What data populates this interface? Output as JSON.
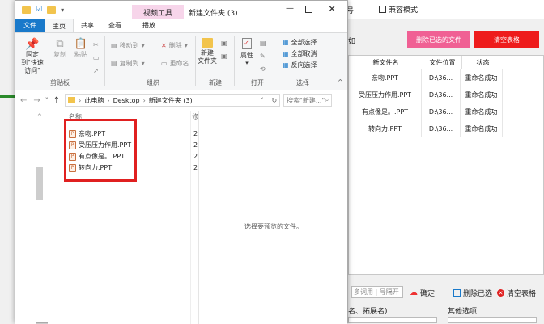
{
  "explorer": {
    "title": "新建文件夹 (3)",
    "context_tab": "视频工具",
    "tabs": [
      "文件",
      "主页",
      "共享",
      "查看",
      "播放"
    ],
    "clipboard": {
      "pin": "固定到\"快速访问\"",
      "copy": "复制",
      "paste": "粘贴",
      "group": "剪贴板"
    },
    "organize": {
      "move_to": "移动到",
      "copy_to": "复制到",
      "delete": "删除",
      "rename": "重命名",
      "group": "组织"
    },
    "new": {
      "new_folder": "新建\n文件夹",
      "group": "新建"
    },
    "open": {
      "properties": "属性",
      "group": "打开"
    },
    "select": {
      "select_all": "全部选择",
      "select_none": "全部取消",
      "invert": "反向选择",
      "group": "选择"
    },
    "address": {
      "crumbs": [
        "此电脑",
        "Desktop",
        "新建文件夹 (3)"
      ],
      "search_placeholder": "搜索\"新建...\""
    },
    "column_name": "名称",
    "column_short": "修",
    "files": [
      {
        "name": "亲吻.PPT",
        "date": "2"
      },
      {
        "name": "受压压力作用.PPT",
        "date": "2"
      },
      {
        "name": "有点像是。.PPT",
        "date": "2"
      },
      {
        "name": "转向力.PPT",
        "date": "2"
      }
    ],
    "preview_text": "选择要预览的文件。"
  },
  "bgapp": {
    "top_label": "号",
    "checkbox_label": "兼容模式",
    "side_label": "如",
    "delete_selected": "删除已选的文件",
    "clear_table": "清空表格",
    "columns": [
      "新文件名",
      "文件位置",
      "状态"
    ],
    "rows": [
      {
        "name": "亲吻.PPT",
        "loc": "D:\\36...",
        "status": "重命名成功"
      },
      {
        "name": "受压压力作用.PPT",
        "loc": "D:\\36...",
        "status": "重命名成功"
      },
      {
        "name": "有点像是。.PPT",
        "loc": "D:\\36...",
        "status": "重命名成功"
      },
      {
        "name": "转向力.PPT",
        "loc": "D:\\36...",
        "status": "重命名成功"
      }
    ],
    "input_placeholder": "多词用 | 号隔开",
    "confirm": "确定",
    "delete_selected2": "删除已选",
    "clear_table2": "清空表格",
    "section_left": "名、拓展名)",
    "section_right": "其他选项"
  },
  "colors": {
    "accent_blue": "#1979ca",
    "highlight_red": "#e02020",
    "pink_button": "#f06094",
    "red_button": "#ee1c1c",
    "context_tab": "#f7d5ea"
  }
}
